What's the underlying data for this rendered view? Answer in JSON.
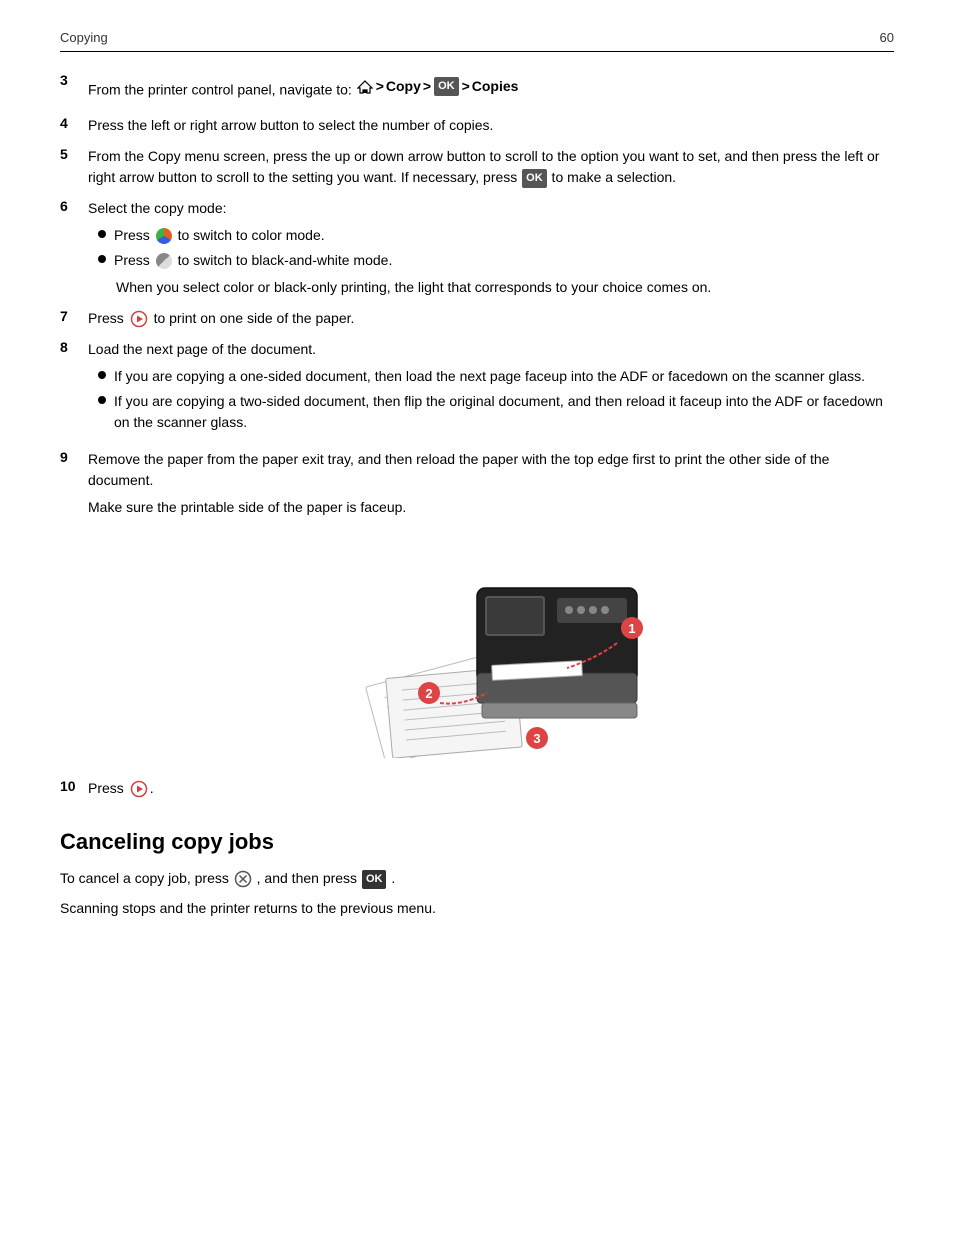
{
  "header": {
    "title": "Copying",
    "page_number": "60"
  },
  "steps": {
    "step3": {
      "number": "3",
      "text": "From the printer control panel, navigate to:"
    },
    "step3_nav": {
      "home": "home",
      "arrow1": ">",
      "copy": "Copy",
      "arrow2": ">",
      "ok": "OK",
      "arrow3": ">",
      "copies": "Copies"
    },
    "step4": {
      "number": "4",
      "text": "Press the left or right arrow button to select the number of copies."
    },
    "step5": {
      "number": "5",
      "text": "From the Copy menu screen, press the up or down arrow button to scroll to the option you want to set, and then press the left or right arrow button to scroll to the setting you want. If necessary, press",
      "ok_label": "OK",
      "text2": "to make a selection."
    },
    "step6": {
      "number": "6",
      "text": "Select the copy mode:"
    },
    "step6_bullet1": "Press",
    "step6_bullet1b": "to switch to color mode.",
    "step6_bullet2": "Press",
    "step6_bullet2b": "to switch to black-and-white mode.",
    "step6_note": "When you select color or black-only printing, the light that corresponds to your choice comes on.",
    "step7": {
      "number": "7",
      "text": "Press",
      "text2": "to print on one side of the paper."
    },
    "step8": {
      "number": "8",
      "text": "Load the next page of the document."
    },
    "step8_bullet1": "If you are copying a one-sided document, then load the next page faceup into the ADF or facedown on the scanner glass.",
    "step8_bullet2": "If you are copying a two-sided document, then flip the original document, and then reload it faceup into the ADF or facedown on the scanner glass.",
    "step9": {
      "number": "9",
      "text": "Remove the paper from the paper exit tray, and then reload the paper with the top edge first to print the other side of the document."
    },
    "step9_note": "Make sure the printable side of the paper is faceup.",
    "step10": {
      "number": "10",
      "text": "Press"
    },
    "section_title": "Canceling copy jobs",
    "cancel_para1_start": "To cancel a copy job, press",
    "cancel_para1_mid": ", and then press",
    "cancel_para1_end": ".",
    "cancel_para2": "Scanning stops and the printer returns to the previous menu."
  }
}
